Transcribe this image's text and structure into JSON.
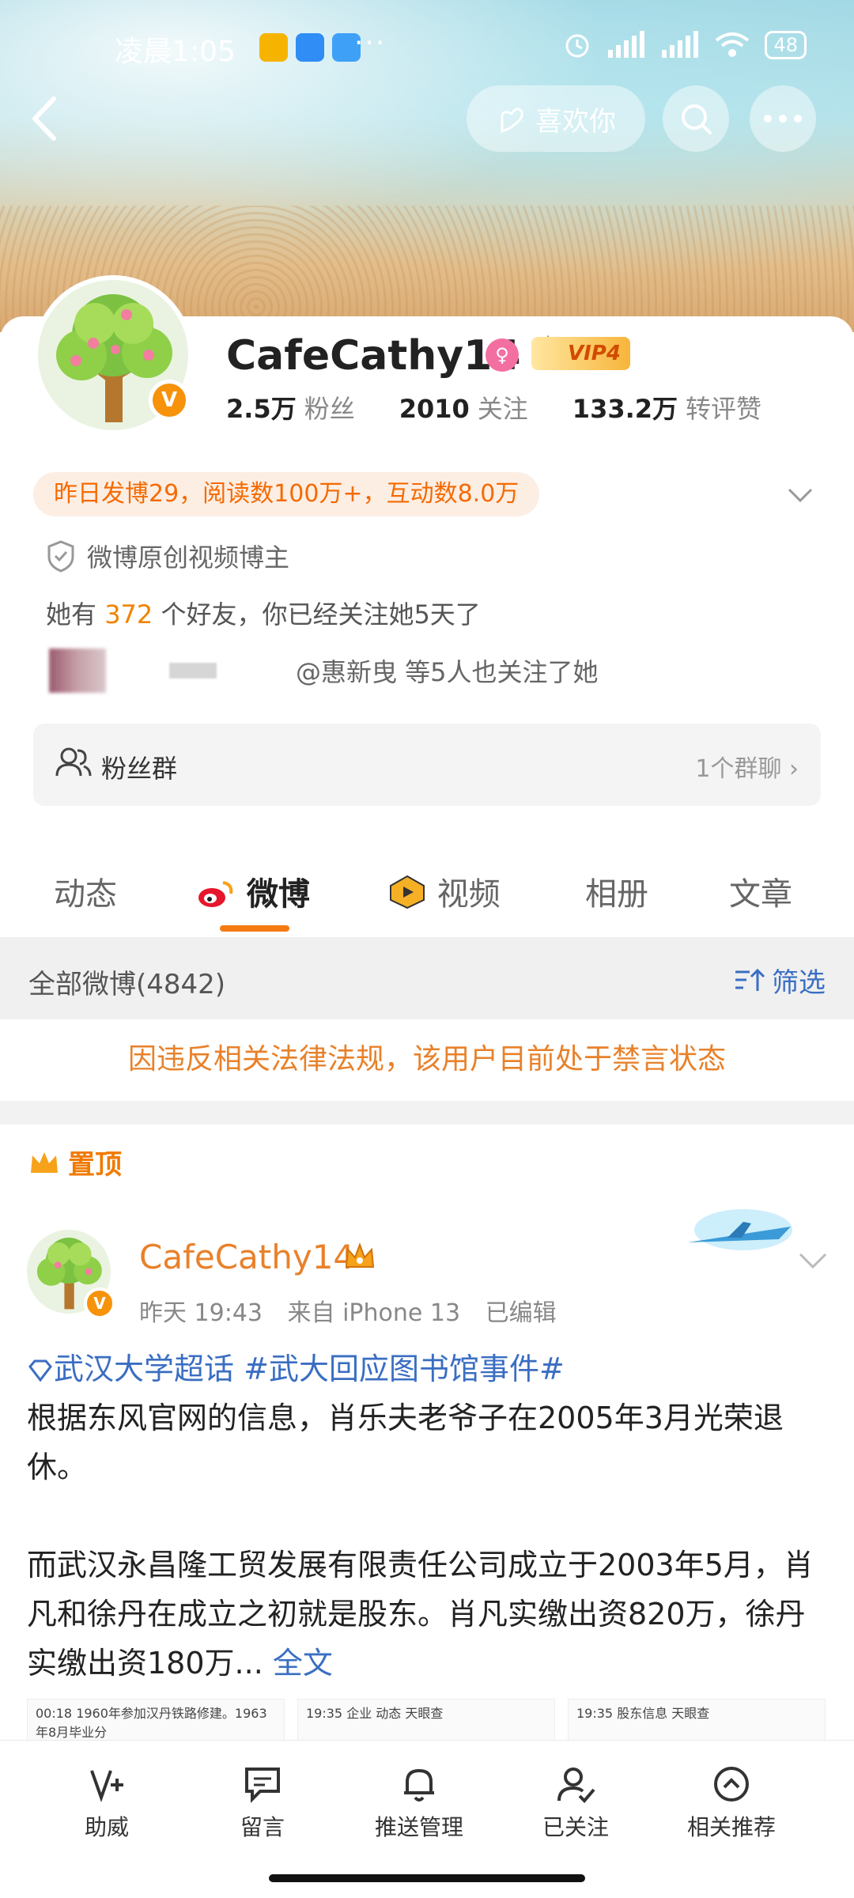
{
  "status_bar": {
    "time": "凌晨1:05",
    "more": "···",
    "battery": "48"
  },
  "header": {
    "like_label": "喜欢你"
  },
  "profile": {
    "username": "CafeCathy14",
    "vip_label": "VIP4",
    "stats": [
      {
        "value": "2.5万",
        "label": "粉丝"
      },
      {
        "value": "2010",
        "label": "关注"
      },
      {
        "value": "133.2万",
        "label": "转评赞"
      }
    ],
    "activity": "昨日发博29，阅读数100万+，互动数8.0万",
    "creator_label": "微博原创视频博主",
    "friends_prefix": "她有",
    "friends_count": "372",
    "friends_suffix": "个好友，你已经关注她5天了",
    "mutual_text": "@惠新曳 等5人也关注了她",
    "fan_group_label": "粉丝群",
    "fan_group_count": "1个群聊"
  },
  "tabs": [
    {
      "label": "动态"
    },
    {
      "label": "微博"
    },
    {
      "label": "视频"
    },
    {
      "label": "相册"
    },
    {
      "label": "文章"
    }
  ],
  "filter_bar": {
    "all_label": "全部微博(4842)",
    "filter_label": "筛选"
  },
  "notice": "因违反相关法律法规，该用户目前处于禁言状态",
  "post": {
    "pinned_label": "置顶",
    "author": "CafeCathy14",
    "time": "昨天 19:43",
    "source": "来自 iPhone 13",
    "edited": "已编辑",
    "topic_super": "武汉大学超话",
    "topic_hashtag": "#武大回应图书馆事件#",
    "para1": "根据东风官网的信息，肖乐夫老爷子在2005年3月光荣退休。",
    "para2": "而武汉永昌隆工贸发展有限责任公司成立于2003年5月，肖凡和徐丹在成立之初就是股东。肖凡实缴出资820万，徐丹实缴出资180万...",
    "more_label": "全文",
    "thumb1": "00:18  1960年参加汉丹铁路修建。1963年8月毕业分",
    "thumb2": "19:35  企业  动态  天眼查",
    "thumb3": "19:35  股东信息  天眼查"
  },
  "bottom_nav": [
    {
      "label": "助威",
      "icon": "cheer-icon"
    },
    {
      "label": "留言",
      "icon": "message-icon"
    },
    {
      "label": "推送管理",
      "icon": "bell-icon"
    },
    {
      "label": "已关注",
      "icon": "followed-icon"
    },
    {
      "label": "相关推荐",
      "icon": "recommend-icon"
    }
  ]
}
